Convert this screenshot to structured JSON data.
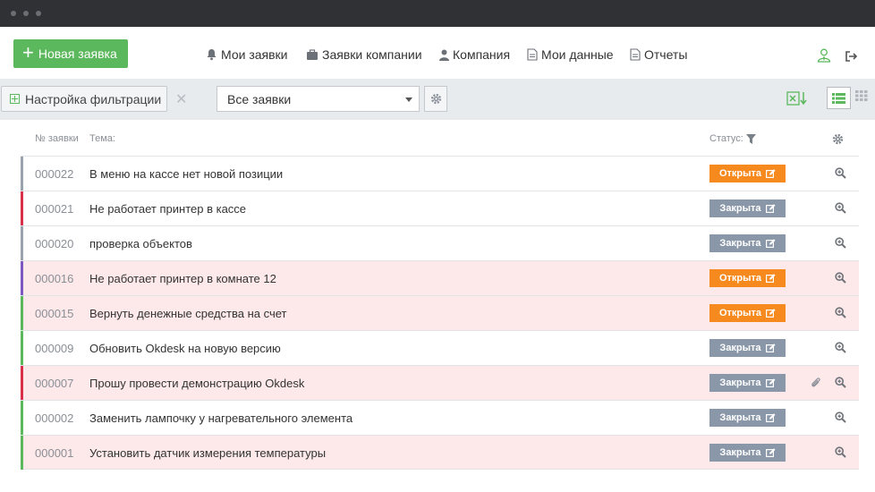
{
  "topnav": {
    "new_ticket": "Новая заявка",
    "items": [
      {
        "label": "Мои заявки",
        "icon": "bell-icon"
      },
      {
        "label": "Заявки компании",
        "icon": "briefcase-icon"
      },
      {
        "label": "Компания",
        "icon": "user-icon"
      },
      {
        "label": "Мои данные",
        "icon": "document-icon"
      },
      {
        "label": "Отчеты",
        "icon": "document-icon"
      }
    ],
    "right_icons": [
      "user-tie-icon",
      "logout-icon"
    ]
  },
  "filterbar": {
    "filter_settings": "Настройка фильтрации",
    "clear_icon": "close-icon",
    "select_value": "Все заявки"
  },
  "table": {
    "headers": {
      "number": "№ заявки",
      "theme": "Тема:",
      "status": "Статус:"
    },
    "rows": [
      {
        "number": "000022",
        "subject": "В меню на кассе нет новой позиции",
        "status": "Открыта",
        "state": "open",
        "stripe": "#9aa3ad",
        "highlight": false,
        "attachment": false
      },
      {
        "number": "000021",
        "subject": "Не работает принтер в кассе",
        "status": "Закрыта",
        "state": "closed",
        "stripe": "#d9304a",
        "highlight": false,
        "attachment": false
      },
      {
        "number": "000020",
        "subject": "проверка объектов",
        "status": "Закрыта",
        "state": "closed",
        "stripe": "#9aa3ad",
        "highlight": false,
        "attachment": false
      },
      {
        "number": "000016",
        "subject": "Не работает принтер в комнате 12",
        "status": "Открыта",
        "state": "open",
        "stripe": "#7e57c2",
        "highlight": true,
        "attachment": false
      },
      {
        "number": "000015",
        "subject": "Вернуть денежные средства на счет",
        "status": "Открыта",
        "state": "open",
        "stripe": "#5cb85c",
        "highlight": true,
        "attachment": false
      },
      {
        "number": "000009",
        "subject": "Обновить Okdesk на новую версию",
        "status": "Закрыта",
        "state": "closed",
        "stripe": "#5cb85c",
        "highlight": false,
        "attachment": false
      },
      {
        "number": "000007",
        "subject": "Прошу провести демонстрацию Okdesk",
        "status": "Закрыта",
        "state": "closed",
        "stripe": "#d9304a",
        "highlight": true,
        "attachment": true
      },
      {
        "number": "000002",
        "subject": "Заменить лампочку у нагревательного элемента",
        "status": "Закрыта",
        "state": "closed",
        "stripe": "#5cb85c",
        "highlight": false,
        "attachment": false
      },
      {
        "number": "000001",
        "subject": "Установить датчик измерения температуры",
        "status": "Закрыта",
        "state": "closed",
        "stripe": "#5cb85c",
        "highlight": true,
        "attachment": false
      }
    ]
  },
  "colors": {
    "accent_green": "#5cb85c",
    "status_open": "#f68a1f",
    "status_closed": "#8a97a8",
    "row_highlight": "#fde9ea"
  }
}
